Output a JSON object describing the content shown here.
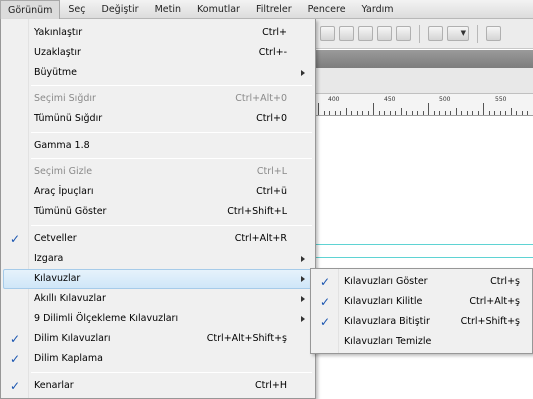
{
  "menubar": {
    "items": [
      {
        "label": "Görünüm",
        "active": true
      },
      {
        "label": "Seç"
      },
      {
        "label": "Değiştir"
      },
      {
        "label": "Metin"
      },
      {
        "label": "Komutlar"
      },
      {
        "label": "Filtreler"
      },
      {
        "label": "Pencere"
      },
      {
        "label": "Yardım"
      }
    ]
  },
  "menu": {
    "items": [
      {
        "label": "Yakınlaştır",
        "shortcut": "Ctrl+"
      },
      {
        "label": "Uzaklaştır",
        "shortcut": "Ctrl+-"
      },
      {
        "label": "Büyütme",
        "submenu": true
      },
      {
        "label": "Seçimi Sığdır",
        "shortcut": "Ctrl+Alt+0",
        "disabled": true
      },
      {
        "label": "Tümünü Sığdır",
        "shortcut": "Ctrl+0"
      },
      {
        "label": "Gamma 1.8"
      },
      {
        "label": "Seçimi Gizle",
        "shortcut": "Ctrl+L",
        "disabled": true
      },
      {
        "label": "Araç İpuçları",
        "shortcut": "Ctrl+ü"
      },
      {
        "label": "Tümünü Göster",
        "shortcut": "Ctrl+Shift+L"
      },
      {
        "label": "Cetveller",
        "shortcut": "Ctrl+Alt+R",
        "checked": true
      },
      {
        "label": "Izgara",
        "submenu": true
      },
      {
        "label": "Kılavuzlar",
        "submenu": true,
        "highlighted": true
      },
      {
        "label": "Akıllı Kılavuzlar",
        "submenu": true
      },
      {
        "label": "9 Dilimli Ölçekleme Kılavuzları",
        "submenu": true
      },
      {
        "label": "Dilim Kılavuzları",
        "shortcut": "Ctrl+Alt+Shift+ş",
        "checked": true
      },
      {
        "label": "Dilim Kaplama",
        "checked": true
      },
      {
        "label": "Kenarlar",
        "shortcut": "Ctrl+H",
        "checked": true
      }
    ],
    "check_glyph": "✓"
  },
  "submenu": {
    "items": [
      {
        "label": "Kılavuzları Göster",
        "shortcut": "Ctrl+ş",
        "checked": true
      },
      {
        "label": "Kılavuzları Kilitle",
        "shortcut": "Ctrl+Alt+ş",
        "checked": true
      },
      {
        "label": "Kılavuzlara Bitiştir",
        "shortcut": "Ctrl+Shift+ş",
        "checked": true
      },
      {
        "label": "Kılavuzları Temizle"
      }
    ]
  },
  "ruler": {
    "labels": [
      "400",
      "450",
      "500",
      "550"
    ]
  },
  "colors": {
    "guide": "#5fd3d3",
    "check": "#1a55b0",
    "highlight": "#cfe6f8"
  }
}
